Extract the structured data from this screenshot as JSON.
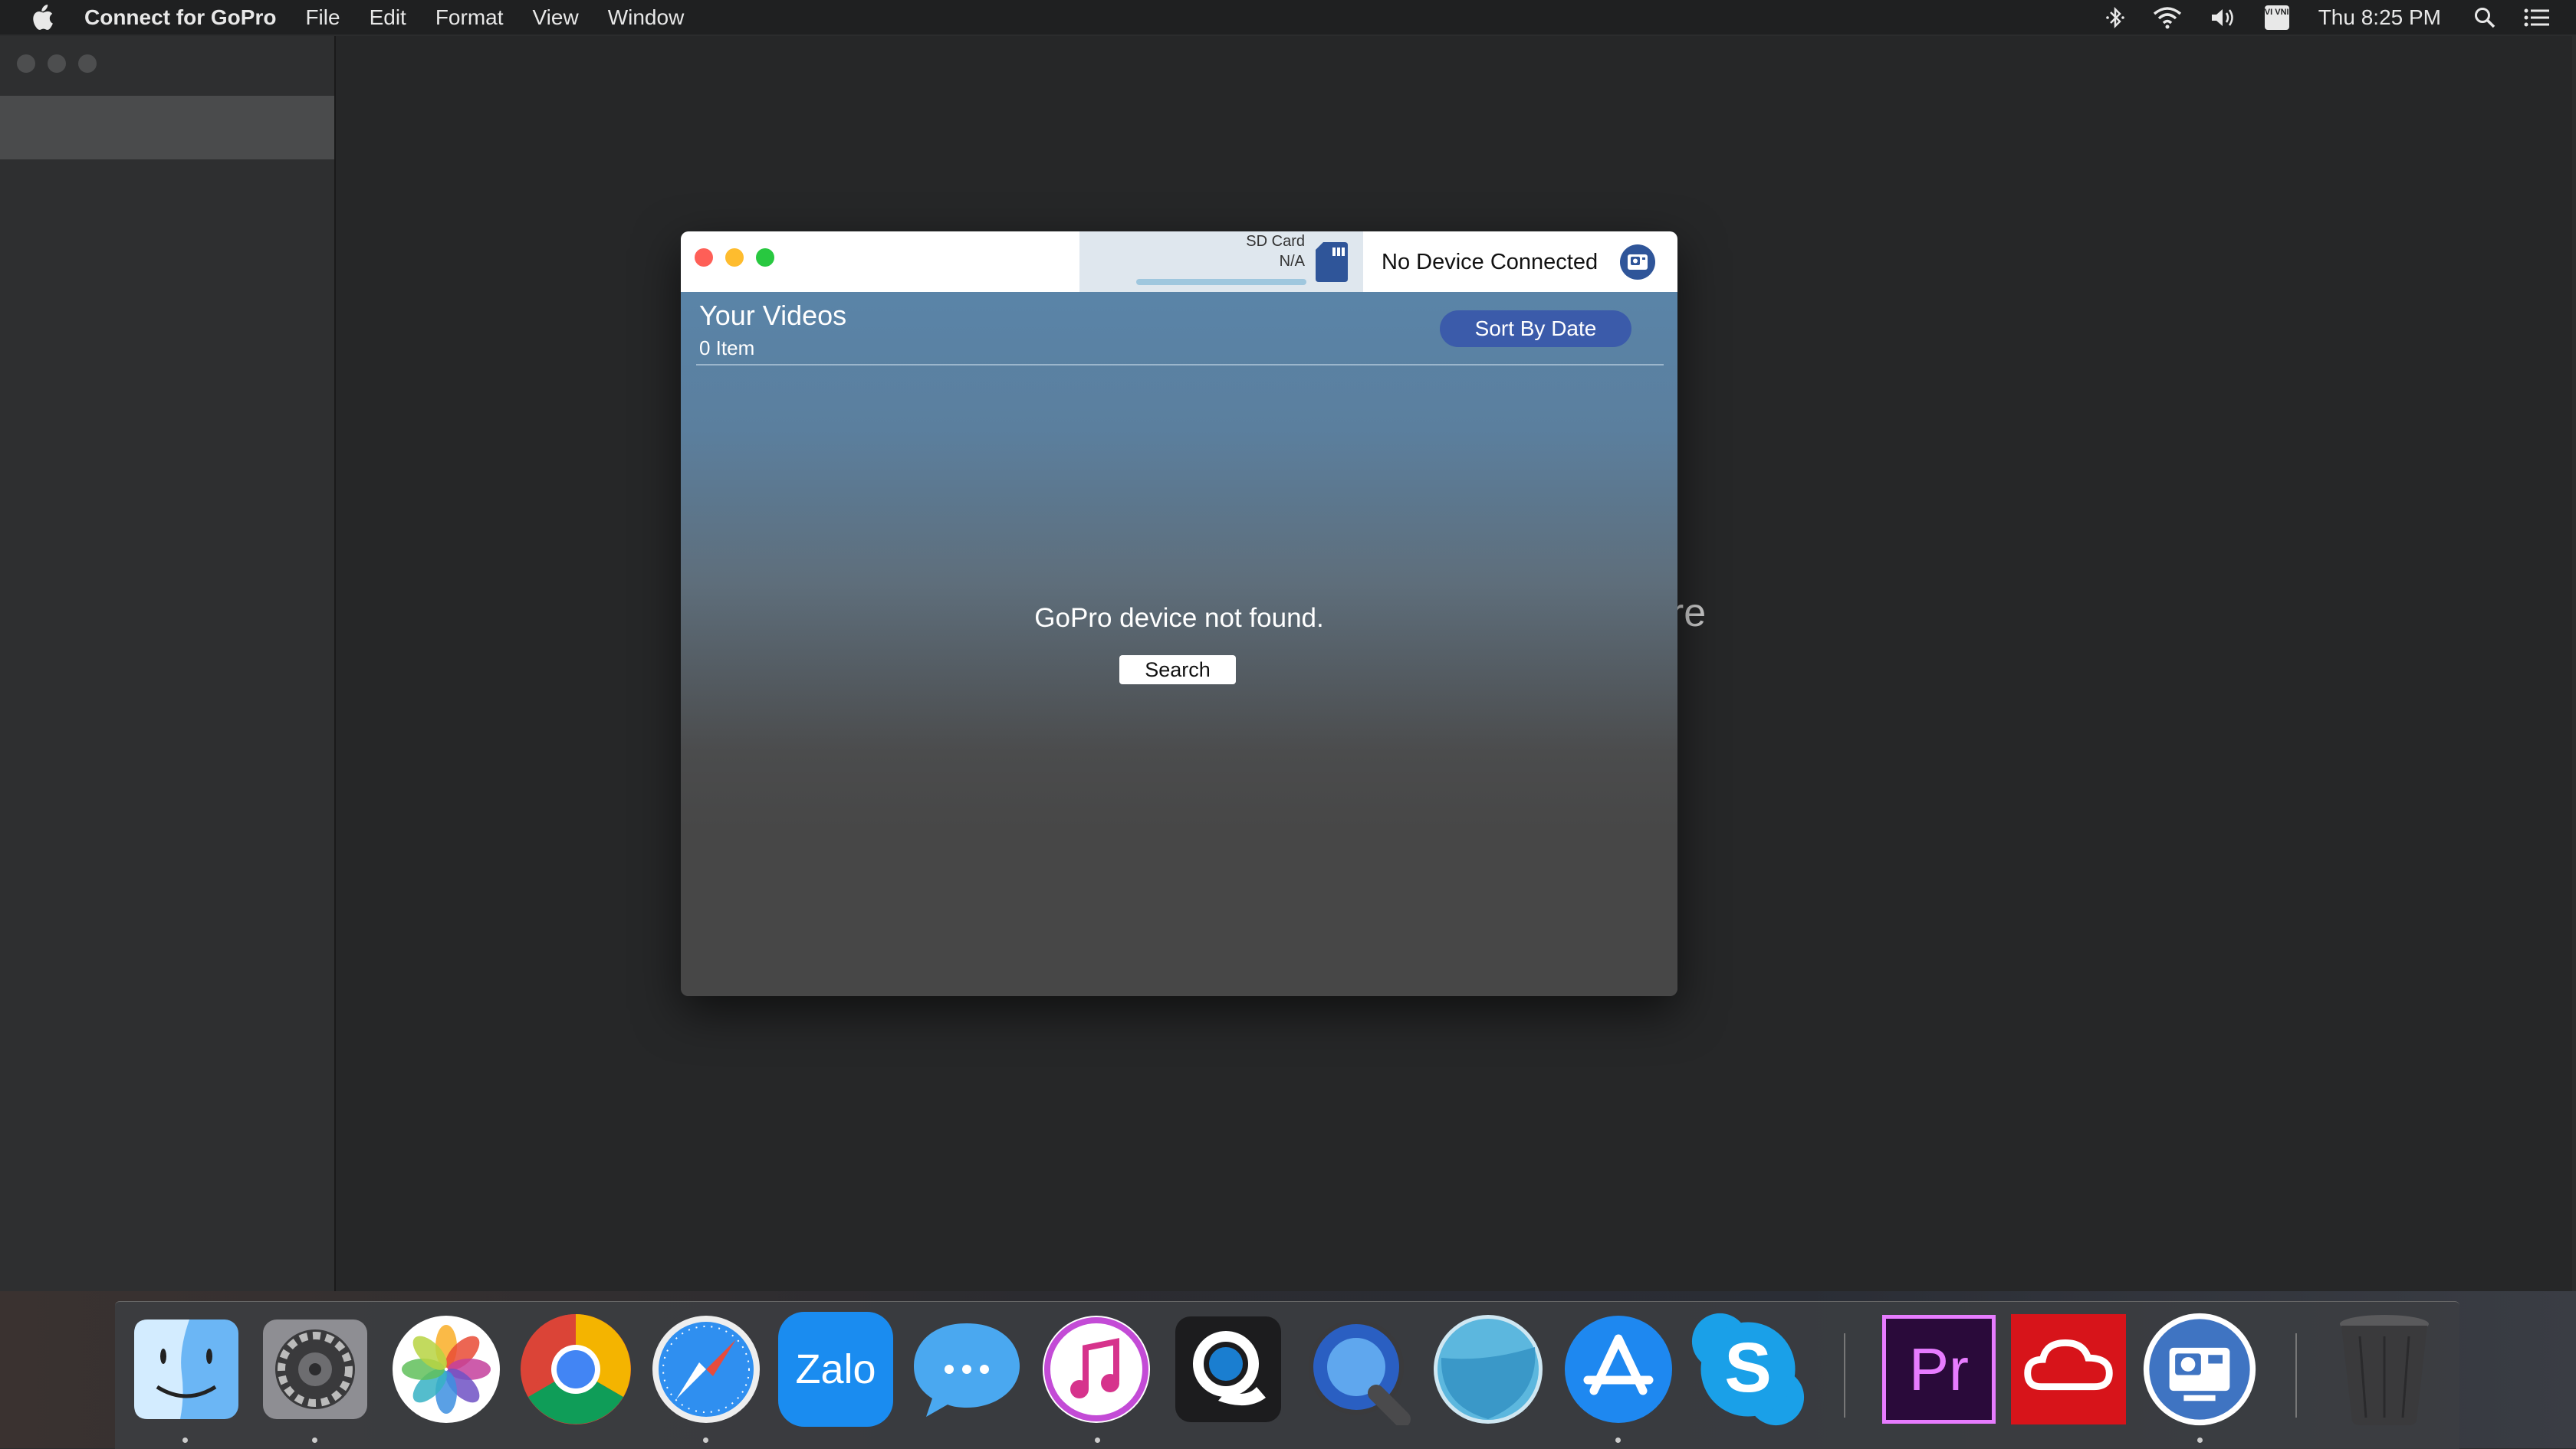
{
  "menubar": {
    "app_name": "Connect for GoPro",
    "menus": [
      "File",
      "Edit",
      "Format",
      "View",
      "Window"
    ],
    "clock": "Thu 8:25 PM",
    "input_source": "VI VNI"
  },
  "background_window": {
    "partial_text": "ore"
  },
  "gopro_window": {
    "sd_card_label": "SD Card",
    "sd_card_value": "N/A",
    "device_status": "No Device Connected",
    "videos_title": "Your Videos",
    "item_count": "0 Item",
    "sort_button": "Sort By Date",
    "message": "GoPro device not found.",
    "search_button": "Search"
  },
  "colors": {
    "close": "#fe5f57",
    "minimize": "#febc2e",
    "zoom": "#28c840",
    "accent": "#3b5baa"
  },
  "dock": {
    "apps": [
      "Finder",
      "System Preferences",
      "Photos",
      "Google Chrome",
      "Safari",
      "Zalo",
      "Messages",
      "iTunes",
      "QuickTime Player",
      "QuickTime Player 7",
      "Browser",
      "App Store",
      "Skype",
      "Adobe Premiere Pro",
      "Adobe Creative Cloud",
      "Connect for GoPro",
      "Trash"
    ],
    "zalo_label": "Zalo",
    "premiere_label": "Pr"
  }
}
